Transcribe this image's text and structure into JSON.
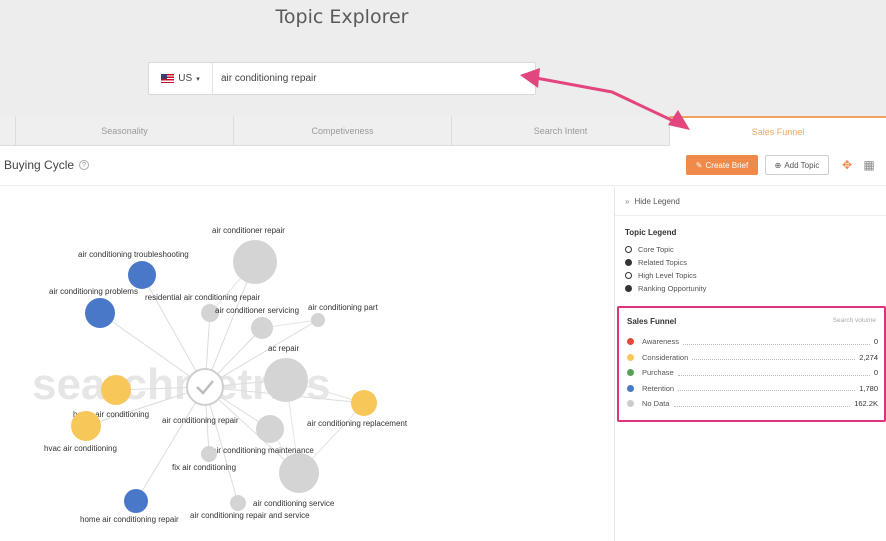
{
  "header": {
    "title": "Topic Explorer",
    "country": "US",
    "search_value": "air conditioning repair"
  },
  "tabs": [
    {
      "label": "Seasonality"
    },
    {
      "label": "Competiveness"
    },
    {
      "label": "Search Intent"
    },
    {
      "label": "Sales Funnel",
      "active": true
    }
  ],
  "toolbar": {
    "section_title": "Buying Cycle",
    "help": "?",
    "create_brief": "Create Brief",
    "add_topic": "Add Topic"
  },
  "legend": {
    "hide_label": "Hide Legend",
    "topic_legend_title": "Topic Legend",
    "topic_items": [
      {
        "label": "Core Topic",
        "style": "hollow"
      },
      {
        "label": "Related Topics",
        "style": "solid"
      },
      {
        "label": "High Level Topics",
        "style": "hollow"
      },
      {
        "label": "Ranking Opportunity",
        "style": "solid"
      }
    ],
    "sales_funnel": {
      "title": "Sales Funnel",
      "subtitle": "Search volume",
      "rows": [
        {
          "label": "Awareness",
          "value": "0",
          "color": "#e04a3d"
        },
        {
          "label": "Consideration",
          "value": "2,274",
          "color": "#f7c75a"
        },
        {
          "label": "Purchase",
          "value": "0",
          "color": "#5aa05c"
        },
        {
          "label": "Retention",
          "value": "1,780",
          "color": "#4a78c8"
        },
        {
          "label": "No Data",
          "value": "162.2K",
          "color": "#cccccc"
        }
      ]
    }
  },
  "graph": {
    "watermark": "searchmetrics",
    "center_label": "air conditioning repair",
    "nodes": [
      {
        "label": "air conditioner repair",
        "color": "#d4d4d4"
      },
      {
        "label": "air conditioning troubleshooting",
        "color": "#4a78c8"
      },
      {
        "label": "air conditioning problems",
        "color": "#4a78c8"
      },
      {
        "label": "residential air conditioning repair",
        "color": "#d4d4d4"
      },
      {
        "label": "air conditioner servicing",
        "color": "#d4d4d4"
      },
      {
        "label": "air conditioning part",
        "color": "#d4d4d4"
      },
      {
        "label": "ac repair",
        "color": "#d4d4d4"
      },
      {
        "label": "home air conditioning",
        "color": "#f7c75a"
      },
      {
        "label": "hvac air conditioning",
        "color": "#f7c75a"
      },
      {
        "label": "air conditioning replacement",
        "color": "#f7c75a"
      },
      {
        "label": "air conditioning maintenance",
        "color": "#d4d4d4"
      },
      {
        "label": "fix air conditioning",
        "color": "#d4d4d4"
      },
      {
        "label": "air conditioning service",
        "color": "#d4d4d4"
      },
      {
        "label": "home air conditioning repair",
        "color": "#4a78c8"
      },
      {
        "label": "air conditioning repair and service",
        "color": "#d4d4d4"
      },
      {
        "label": "",
        "color": "#d4d4d4"
      }
    ]
  },
  "colors": {
    "accent": "#f0a35e",
    "create_brief_bg": "#ef8a4a",
    "highlight_box": "#d6357a"
  }
}
